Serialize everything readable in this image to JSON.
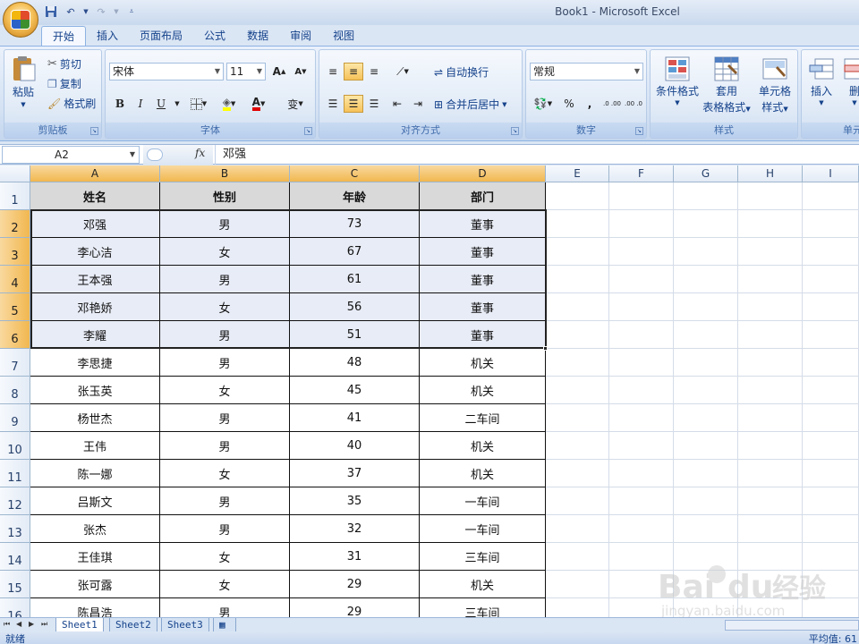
{
  "window": {
    "title": "Book1 - Microsoft Excel"
  },
  "tabs": [
    "开始",
    "插入",
    "页面布局",
    "公式",
    "数据",
    "审阅",
    "视图"
  ],
  "ribbon": {
    "clipboard": {
      "paste": "粘贴",
      "cut": "剪切",
      "copy": "复制",
      "format_painter": "格式刷",
      "group": "剪贴板"
    },
    "font": {
      "name": "宋体",
      "size": "11",
      "bold": "B",
      "italic": "I",
      "underline": "U",
      "grow": "A",
      "shrink": "A",
      "font_color": "A",
      "phonetic": "变",
      "group": "字体"
    },
    "alignment": {
      "wrap": "自动换行",
      "merge": "合并后居中",
      "group": "对齐方式"
    },
    "number": {
      "format": "常规",
      "percent": "%",
      "comma": ",",
      "inc_dec": ".0 .00",
      "dec_dec": ".00 .0",
      "group": "数字"
    },
    "styles": {
      "conditional": "条件格式",
      "table1": "套用",
      "table2": "表格格式",
      "cell1": "单元格",
      "cell2": "样式",
      "group": "样式"
    },
    "cells": {
      "insert": "插入",
      "delete": "删",
      "group": "单元"
    }
  },
  "formula_bar": {
    "name_box": "A2",
    "fx": "fx",
    "content": "邓强"
  },
  "columns": [
    "A",
    "B",
    "C",
    "D",
    "E",
    "F",
    "G",
    "H",
    "I"
  ],
  "table": {
    "headers": [
      "姓名",
      "性别",
      "年龄",
      "部门"
    ],
    "rows": [
      [
        "邓强",
        "男",
        "73",
        "董事"
      ],
      [
        "李心洁",
        "女",
        "67",
        "董事"
      ],
      [
        "王本强",
        "男",
        "61",
        "董事"
      ],
      [
        "邓艳娇",
        "女",
        "56",
        "董事"
      ],
      [
        "李耀",
        "男",
        "51",
        "董事"
      ],
      [
        "李思捷",
        "男",
        "48",
        "机关"
      ],
      [
        "张玉英",
        "女",
        "45",
        "机关"
      ],
      [
        "杨世杰",
        "男",
        "41",
        "二车间"
      ],
      [
        "王伟",
        "男",
        "40",
        "机关"
      ],
      [
        "陈一娜",
        "女",
        "37",
        "机关"
      ],
      [
        "吕斯文",
        "男",
        "35",
        "一车间"
      ],
      [
        "张杰",
        "男",
        "32",
        "一车间"
      ],
      [
        "王佳琪",
        "女",
        "31",
        "三车间"
      ],
      [
        "张可露",
        "女",
        "29",
        "机关"
      ],
      [
        "陈昌浩",
        "男",
        "29",
        "三车间"
      ]
    ]
  },
  "row_numbers": [
    "1",
    "2",
    "3",
    "4",
    "5",
    "6",
    "7",
    "8",
    "9",
    "10",
    "11",
    "12",
    "13",
    "14",
    "15",
    "16"
  ],
  "sheets": [
    "Sheet1",
    "Sheet2",
    "Sheet3"
  ],
  "status": {
    "left": "就绪",
    "right": "平均值: 61"
  },
  "watermark": {
    "line1": "Bai",
    "line2": "du",
    "line3": "经验",
    "sub": "jingyan.baidu.com"
  }
}
